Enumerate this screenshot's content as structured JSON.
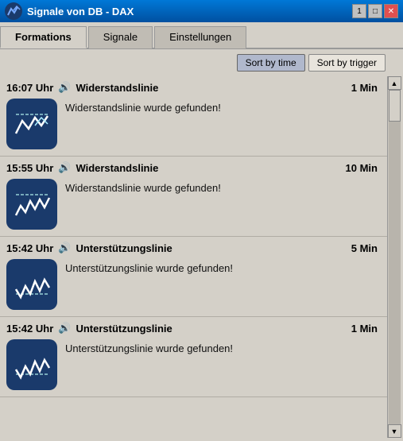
{
  "titleBar": {
    "logo": ">>",
    "title": "Signale von DB - DAX",
    "btn1": "1",
    "btn2": "□",
    "btn3": "✕"
  },
  "tabs": [
    {
      "label": "Formations",
      "active": true
    },
    {
      "label": "Signale",
      "active": false
    },
    {
      "label": "Einstellungen",
      "active": false
    }
  ],
  "sortButtons": [
    {
      "label": "Sort by time",
      "active": true
    },
    {
      "label": "Sort by trigger",
      "active": false
    }
  ],
  "signals": [
    {
      "time": "16:07 Uhr",
      "sound": "🔊",
      "name": "Widerstandslinie",
      "min": "1 Min",
      "desc": "Widerstandslinie wurde gefunden!",
      "iconType": "widerstand"
    },
    {
      "time": "15:55 Uhr",
      "sound": "🔊",
      "name": "Widerstandslinie",
      "min": "10 Min",
      "desc": "Widerstandslinie wurde gefunden!",
      "iconType": "widerstand2"
    },
    {
      "time": "15:42 Uhr",
      "sound": "🔊",
      "name": "Unterstützungslinie",
      "min": "5 Min",
      "desc": "Unterstützungslinie wurde gefunden!",
      "iconType": "unterstutzung"
    },
    {
      "time": "15:42 Uhr",
      "sound": "🔊",
      "name": "Unterstützungslinie",
      "min": "1 Min",
      "desc": "Unterstützungslinie wurde gefunden!",
      "iconType": "unterstutzung"
    }
  ]
}
